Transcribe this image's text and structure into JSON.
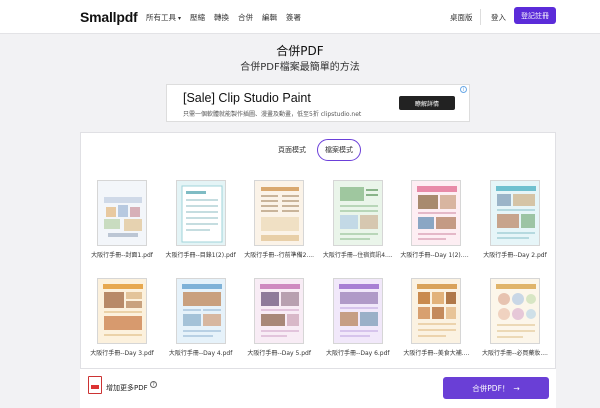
{
  "brand": {
    "logo": "Smallpdf",
    "accent": "#5b2bd9"
  },
  "nav": {
    "items": [
      {
        "label": "所有工具",
        "caret": "▾"
      },
      {
        "label": "壓縮"
      },
      {
        "label": "轉換"
      },
      {
        "label": "合併"
      },
      {
        "label": "編輯"
      },
      {
        "label": "簽署"
      }
    ],
    "desktop": "桌面版",
    "login": "登入",
    "signup": "登記註冊"
  },
  "hero": {
    "title": "合併PDF",
    "subtitle": "合併PDF檔案最簡單的方法"
  },
  "ad": {
    "title": "[Sale] Clip Studio Paint",
    "description": "只需一個軟體就能製作插圖、漫畫及動畫，低至5折 clipstudio.net",
    "button": "瞭解詳情",
    "info": "i"
  },
  "modes": [
    {
      "label": "頁面模式",
      "active": false
    },
    {
      "label": "檔案模式",
      "active": true
    }
  ],
  "files": [
    {
      "name": "大阪行手冊--封面1.pdf",
      "tint": "#e9eef6"
    },
    {
      "name": "大阪行手冊--目錄1(2).pdf",
      "tint": "#dff1f3"
    },
    {
      "name": "大阪行手冊--行前準備2....",
      "tint": "#f7efe3"
    },
    {
      "name": "大阪行手冊--住宿資訊4....",
      "tint": "#e6f3e6"
    },
    {
      "name": "大阪行手冊--Day 1(2).pdf",
      "tint": "#fbe7ee"
    },
    {
      "name": "大阪行手冊--Day 2.pdf",
      "tint": "#e1f2f5"
    },
    {
      "name": "大阪行手冊--Day 3.pdf",
      "tint": "#fbefd9"
    },
    {
      "name": "大阪行手冊--Day 4.pdf",
      "tint": "#e2f0f8"
    },
    {
      "name": "大阪行手冊--Day 5.pdf",
      "tint": "#f6e6f3"
    },
    {
      "name": "大阪行手冊--Day 6.pdf",
      "tint": "#efe4f7"
    },
    {
      "name": "大阪行手冊--美食大補....",
      "tint": "#f8efdf"
    },
    {
      "name": "大阪行手冊--必買藥妝....",
      "tint": "#f9f3e6"
    }
  ],
  "footer": {
    "add_more": "增加更多PDF",
    "help": "?",
    "merge": "合併PDF！",
    "arrow": "→"
  }
}
